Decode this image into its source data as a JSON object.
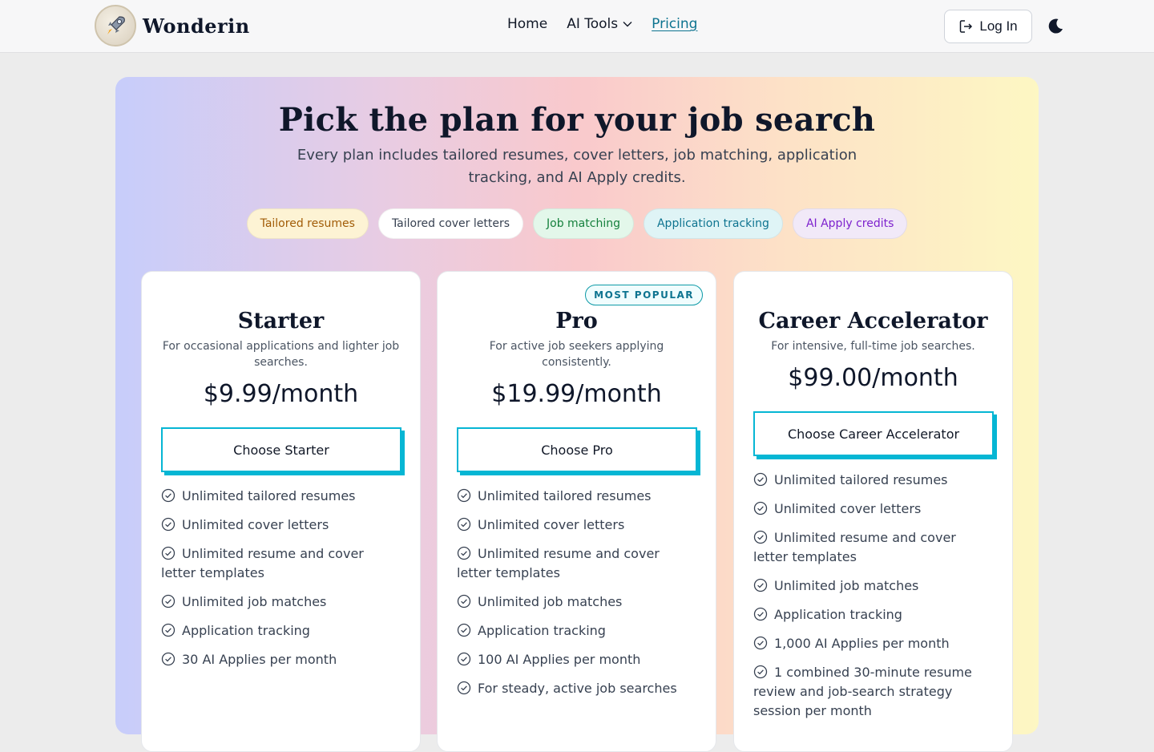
{
  "nav": {
    "brand": "Wonderin",
    "links": [
      {
        "label": "Home"
      },
      {
        "label": "AI Tools"
      },
      {
        "label": "Pricing"
      }
    ],
    "login_label": "Log In"
  },
  "hero": {
    "title": "Pick the plan for your job search",
    "subtitle": "Every plan includes tailored resumes, cover letters, job matching, application tracking, and AI Apply credits.",
    "pills": [
      {
        "label": "Tailored resumes",
        "bg": "#fdf3d4",
        "fg": "#a15c07"
      },
      {
        "label": "Tailored cover letters",
        "bg": "#ffffff",
        "fg": "#374151"
      },
      {
        "label": "Job matching",
        "bg": "#e3f7ea",
        "fg": "#15803d"
      },
      {
        "label": "Application tracking",
        "bg": "#dff4f6",
        "fg": "#0e7490"
      },
      {
        "label": "AI Apply credits",
        "bg": "#f1e9f8",
        "fg": "#7e22ce"
      }
    ]
  },
  "plans": [
    {
      "name": "Starter",
      "description": "For occasional applications and lighter job searches.",
      "price": "$9.99/month",
      "cta": "Choose Starter",
      "features": [
        "Unlimited tailored resumes",
        "Unlimited cover letters",
        "Unlimited resume and cover letter templates",
        "Unlimited job matches",
        "Application tracking",
        "30 AI Applies per month"
      ]
    },
    {
      "name": "Pro",
      "badge": "MOST POPULAR",
      "description": "For active job seekers applying consistently.",
      "price": "$19.99/month",
      "cta": "Choose Pro",
      "features": [
        "Unlimited tailored resumes",
        "Unlimited cover letters",
        "Unlimited resume and cover letter templates",
        "Unlimited job matches",
        "Application tracking",
        "100 AI Applies per month",
        "For steady, active job searches"
      ]
    },
    {
      "name": "Career Accelerator",
      "description": "For intensive, full-time job searches.",
      "price": "$99.00/month",
      "cta": "Choose Career Accelerator",
      "features": [
        "Unlimited tailored resumes",
        "Unlimited cover letters",
        "Unlimited resume and cover letter templates",
        "Unlimited job matches",
        "Application tracking",
        "1,000 AI Applies per month",
        "1 combined 30-minute resume review and job-search strategy session per month"
      ]
    }
  ],
  "colors": {
    "accent": "#06b6d4",
    "link_active": "#0e7490"
  },
  "icons": {
    "logo": "rocket-icon",
    "dropdown": "chevron-down-icon",
    "login": "log-in-icon",
    "theme": "moon-icon",
    "feature": "check-circle-icon"
  }
}
